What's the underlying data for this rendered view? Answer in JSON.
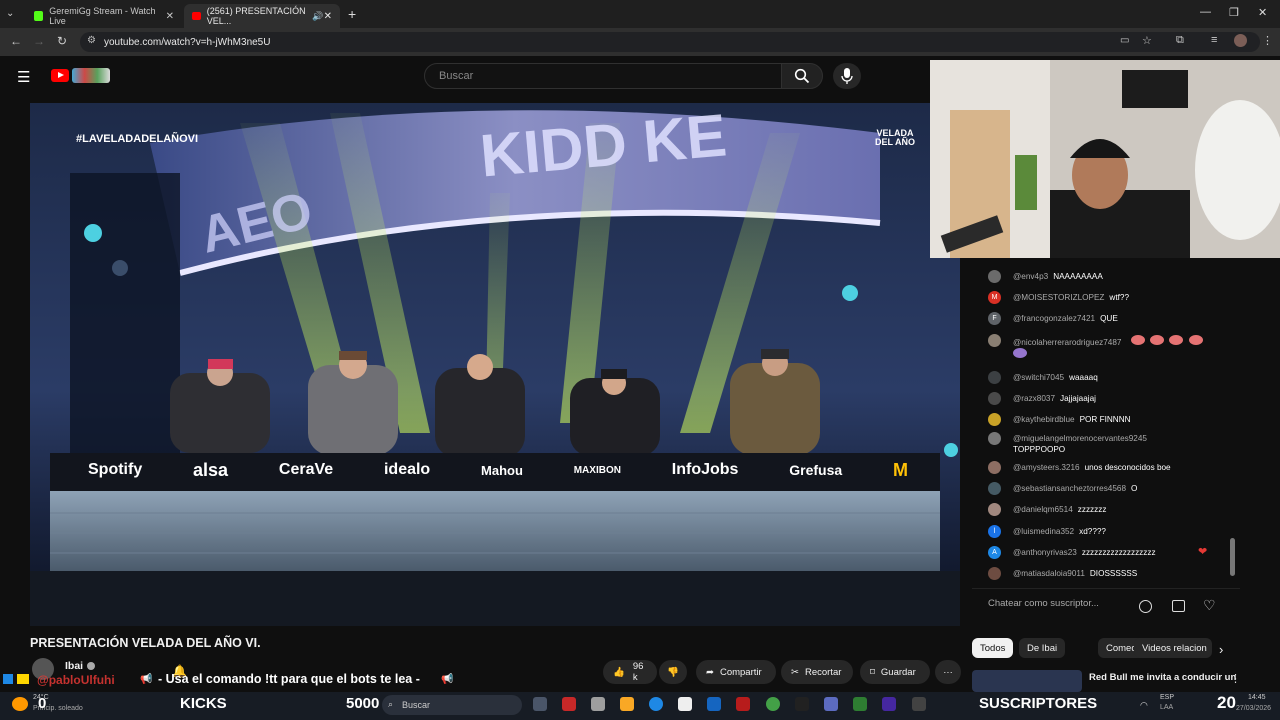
{
  "browser": {
    "tabs": [
      {
        "title": "GeremiGg Stream - Watch Live"
      },
      {
        "title": "(2561) PRESENTACIÓN VEL..."
      }
    ],
    "new_tab": "+",
    "url": "youtube.com/watch?v=h-jWhM3ne5U"
  },
  "youtube": {
    "search_placeholder": "Buscar",
    "video_title": "PRESENTACIÓN VELADA DEL AÑO VI.",
    "channel": "Ibai",
    "like_count": "96 k",
    "actions": {
      "share": "Compartir",
      "clip": "Recortar",
      "save": "Guardar",
      "more": "···"
    },
    "chips": [
      "Todos",
      "De Ibai",
      "Comedias",
      "Videos relacion"
    ],
    "suggested_title": "Red Bull me invita a conducir un",
    "video_overlay": {
      "hashtag": "#LAVELADADELAÑOVI",
      "screen_text": "KIDD KE",
      "screen_text_left": "AEO",
      "velada_logo": "VELADA DEL AÑO",
      "sponsors": [
        "Spotify",
        "alsa",
        "CeraVe",
        "idealo",
        "Mahou",
        "MAXIBON",
        "InfoJobs",
        "Grefusa",
        "M"
      ]
    }
  },
  "chat": {
    "input_placeholder": "Chatear como suscriptor...",
    "messages": [
      {
        "author": "@env4p3",
        "text": "NAAAAAAAA",
        "avatar_color": "#6b6b6b",
        "initial": ""
      },
      {
        "author": "@MOISESTORIZLOPEZ",
        "text": "wtf??",
        "avatar_color": "#d93025",
        "initial": "M"
      },
      {
        "author": "@francogonzalez7421",
        "text": "QUE",
        "avatar_color": "#5f6368",
        "initial": "F"
      },
      {
        "author": "@nicolaherrerarodriguez7487",
        "text": "",
        "avatar_color": "#8a7f73",
        "initial": ""
      },
      {
        "author": "@switchi7045",
        "text": "waaaaq",
        "avatar_color": "#3c4043",
        "initial": ""
      },
      {
        "author": "@razx8037",
        "text": "Jajjajaajaj",
        "avatar_color": "#4a4a4a",
        "initial": ""
      },
      {
        "author": "@kaythebirdblue",
        "text": "POR FINNNN",
        "avatar_color": "#c9a227",
        "initial": ""
      },
      {
        "author": "@miguelangelmorenocervantes9245",
        "text": "TOPPPOOPO",
        "avatar_color": "#777",
        "initial": ""
      },
      {
        "author": "@amysteers.3216",
        "text": "unos desconocidos boe",
        "avatar_color": "#8d6e63",
        "initial": ""
      },
      {
        "author": "@sebastiansancheztorres4568",
        "text": "O",
        "avatar_color": "#455a64",
        "initial": ""
      },
      {
        "author": "@danielqm6514",
        "text": "zzzzzzz",
        "avatar_color": "#a1887f",
        "initial": ""
      },
      {
        "author": "@luismedina352",
        "text": "xd????",
        "avatar_color": "#1a73e8",
        "initial": "l"
      },
      {
        "author": "@anthonyrivas23",
        "text": "zzzzzzzzzzzzzzzzzz",
        "avatar_color": "#1e88e5",
        "initial": "A"
      },
      {
        "author": "@matiasdaloia9011",
        "text": "DIOSSSSSS",
        "avatar_color": "#6d4c41",
        "initial": ""
      }
    ]
  },
  "stream_overlay": {
    "command_text": "- Usa el comando !tt para que el bots te lea -",
    "user_tag": "@pabloUlfuhi",
    "kicks_label": "KICKS",
    "kicks_count": "0",
    "kicks_value": "5000",
    "subs_label": "SUSCRIPTORES",
    "subs_count": "20"
  },
  "taskbar": {
    "weather": "24°C",
    "weather_desc": "Princip. soleado",
    "search_placeholder": "Buscar",
    "lang": "ESP",
    "lang_sub": "LAA",
    "time": "14:45",
    "date": "27/03/2026"
  },
  "colors": {
    "youtube_red": "#ff0000",
    "background": "#0f0f0f",
    "chip_active": "#f1f1f1",
    "heart": "#e53935"
  }
}
